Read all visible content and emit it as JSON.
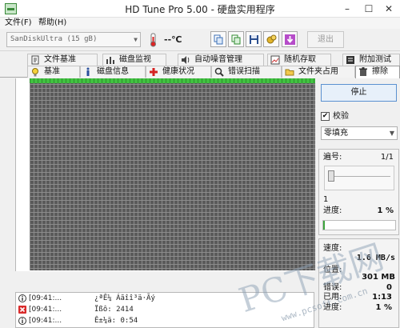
{
  "window": {
    "title": "HD Tune Pro 5.00 - 硬盘实用程序",
    "minimize": "–",
    "maximize": "☐",
    "close": "✕"
  },
  "menu": {
    "file": "文件(F)",
    "help": "帮助(H)"
  },
  "toolbar": {
    "drive": "SanDiskUltra (15 gB)",
    "temperature": "--℃",
    "exit_label": "退出",
    "icons": [
      "copy-icon",
      "copy-info-icon",
      "save-icon",
      "options-icon",
      "download-icon"
    ]
  },
  "tabs_row1": [
    {
      "label": "文件基准",
      "icon": "file-benchmark-icon"
    },
    {
      "label": "磁盘监视",
      "icon": "disk-monitor-icon"
    },
    {
      "label": "自动噪音管理",
      "icon": "noise-icon"
    },
    {
      "label": "随机存取",
      "icon": "random-access-icon"
    },
    {
      "label": "附加测试",
      "icon": "extra-tests-icon"
    }
  ],
  "tabs_row2": [
    {
      "label": "基准",
      "icon": "benchmark-icon"
    },
    {
      "label": "磁盘信息",
      "icon": "info-icon"
    },
    {
      "label": "健康状况",
      "icon": "health-icon"
    },
    {
      "label": "错误扫描",
      "icon": "error-scan-icon"
    },
    {
      "label": "文件夹占用",
      "icon": "folder-usage-icon"
    },
    {
      "label": "擦除",
      "icon": "erase-icon"
    }
  ],
  "active_tab": "擦除",
  "side": {
    "stop_label": "停止",
    "verify_label": "校验",
    "verify_checked": true,
    "fill_mode": "零填充",
    "pass_label": "遍号:",
    "pass_value": "1/1",
    "pass_current": "1",
    "pass_percent": "1 %",
    "progress_label": "进度:",
    "progress_fraction": 0.01,
    "speed_label": "速度:",
    "speed_value": "1.6 MB/s",
    "position_label": "位置:",
    "position_value": "301 MB",
    "errors_label": "错误:",
    "errors_value": "0",
    "elapsed_label": "已用:",
    "elapsed_value": "1:13",
    "progress2_label": "进度:",
    "progress2_value": "1 %"
  },
  "log": [
    {
      "time": "[09:41:...",
      "msg": "¿ªÊ¼ Áãîî³ä·Ãý",
      "icon": "info-icon"
    },
    {
      "time": "[09:41:...",
      "msg": "Ïßô: 2414",
      "icon": "error-icon"
    },
    {
      "time": "[09:41:...",
      "msg": "Ê±¼ä: 0:54",
      "icon": "info-icon"
    }
  ],
  "watermark": {
    "text": "PC下载网",
    "url": "www.pcsoft.com.cn"
  },
  "colors": {
    "accent": "#5b91d0",
    "grid_block": "#5a5a5a",
    "progress_green": "#41c241"
  }
}
